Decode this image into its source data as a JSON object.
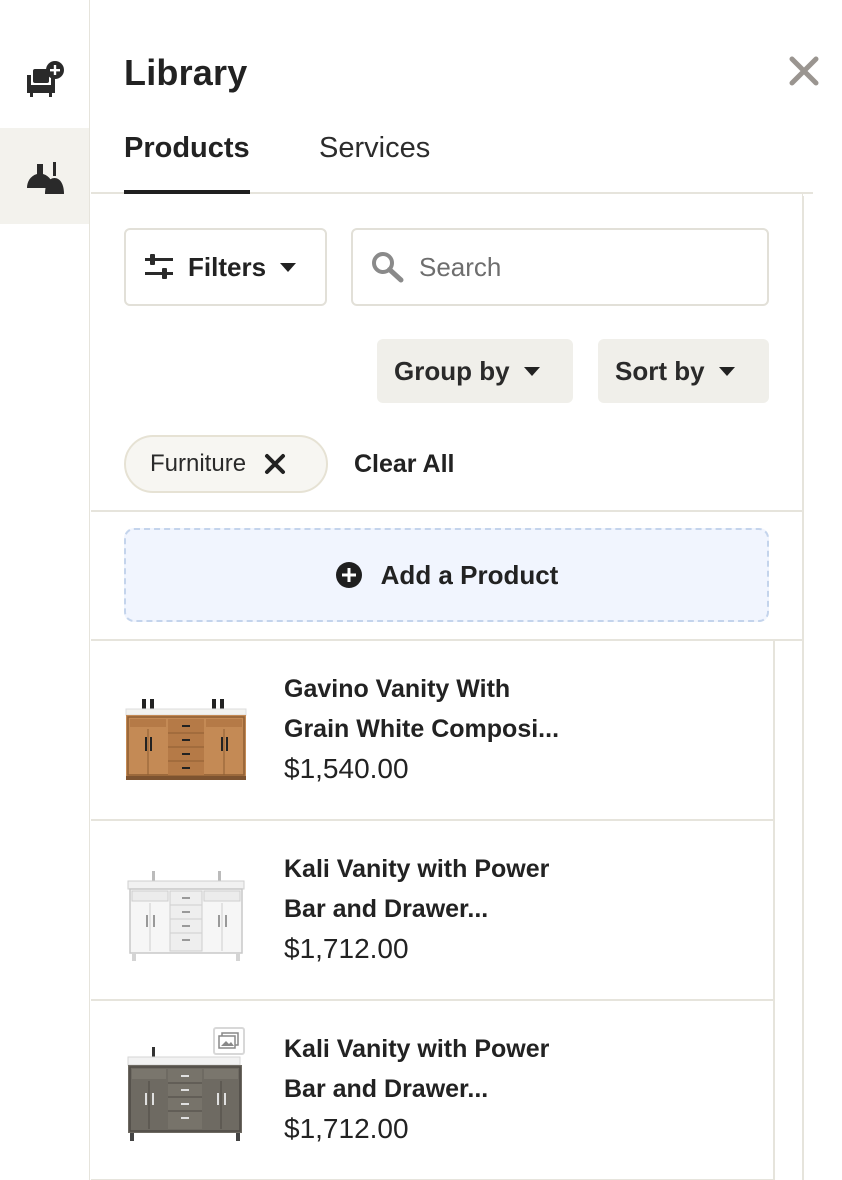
{
  "rail": {
    "items": [
      {
        "name": "add-furniture",
        "icon": "armchair-plus-icon",
        "active": false
      },
      {
        "name": "lamps",
        "icon": "lamp-icon",
        "active": true
      }
    ]
  },
  "panel": {
    "title": "Library",
    "close_icon": "close-icon"
  },
  "tabs": [
    {
      "label": "Products",
      "active": true
    },
    {
      "label": "Services",
      "active": false
    }
  ],
  "toolbar": {
    "filters_label": "Filters",
    "search_placeholder": "Search",
    "search_value": "",
    "group_by_label": "Group by",
    "sort_by_label": "Sort by"
  },
  "active_filters": {
    "chips": [
      {
        "label": "Furniture"
      }
    ],
    "clear_all_label": "Clear All"
  },
  "add_product": {
    "label": "Add a Product"
  },
  "products": [
    {
      "name": "Gavino Vanity With Grain White Composi...",
      "name_line1": "Gavino Vanity With",
      "name_line2": "Grain White Composi...",
      "price": "$1,540.00",
      "finish": "oak",
      "gallery_badge": false
    },
    {
      "name": "Kali Vanity with Power Bar and Drawer...",
      "name_line1": "Kali Vanity with Power",
      "name_line2": "Bar and Drawer...",
      "price": "$1,712.00",
      "finish": "white",
      "gallery_badge": false
    },
    {
      "name": "Kali Vanity with Power Bar and Drawer...",
      "name_line1": "Kali Vanity with Power",
      "name_line2": "Bar and Drawer...",
      "price": "$1,712.00",
      "finish": "gray",
      "gallery_badge": true
    }
  ],
  "colors": {
    "accent_dark": "#1f1f1f",
    "border": "#e6e4dc",
    "add_bg": "#f1f5fe",
    "add_border": "#c4d4ec",
    "pill_bg": "#f0efea"
  }
}
